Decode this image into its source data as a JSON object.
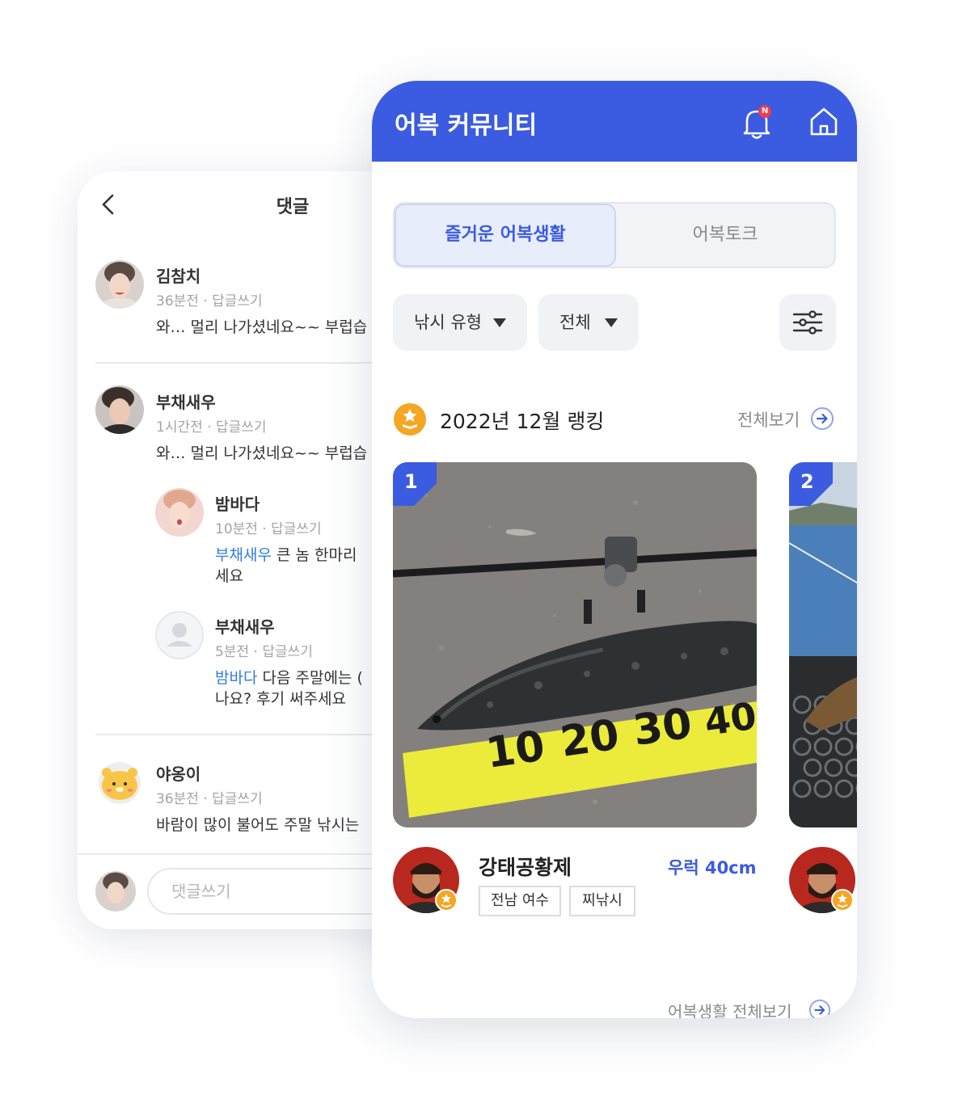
{
  "comments_screen": {
    "title": "댓글",
    "comments": [
      {
        "name": "김참치",
        "time": "36분전",
        "reply": "답글쓰기",
        "text": "와… 멀리 나가셨네요~~ 부럽습"
      },
      {
        "name": "부채새우",
        "time": "1시간전",
        "reply": "답글쓰기",
        "text": "와… 멀리 나가셨네요~~ 부럽습"
      },
      {
        "name": "밤바다",
        "time": "10분전",
        "reply": "답글쓰기",
        "mention": "부채새우",
        "text_line1": " 큰 놈 한마리",
        "text_line2": "세요"
      },
      {
        "name": "부채새우",
        "time": "5분전",
        "reply": "답글쓰기",
        "mention": "밤바다",
        "text_line1": " 다음 주말에는 (",
        "text_line2": "나요? 후기 써주세요"
      },
      {
        "name": "야옹이",
        "time": "36분전",
        "reply": "답글쓰기",
        "text": "바람이 많이 불어도 주말 낚시는"
      }
    ],
    "meta_separator": "·",
    "input_placeholder": "댓글쓰기"
  },
  "community": {
    "header_title": "어복 커뮤니티",
    "notification_badge": "N",
    "tabs": [
      {
        "label": "즐거운 어복생활",
        "active": true
      },
      {
        "label": "어복토크",
        "active": false
      }
    ],
    "filters": {
      "type_label": "낚시 유형",
      "scope_label": "전체"
    },
    "ranking": {
      "title": "2022년 12월 랭킹",
      "see_all": "전체보기",
      "entries": [
        {
          "rank": "1",
          "user": "강태공황제",
          "catch": "우럭 40cm",
          "tags": [
            "전남 여수",
            "찌낚시"
          ]
        },
        {
          "rank": "2"
        }
      ]
    },
    "bottom_link": "어복생활 전체보기"
  },
  "colors": {
    "primary": "#3b5be0",
    "mention": "#2f7ce8",
    "medal": "#f5a623"
  }
}
